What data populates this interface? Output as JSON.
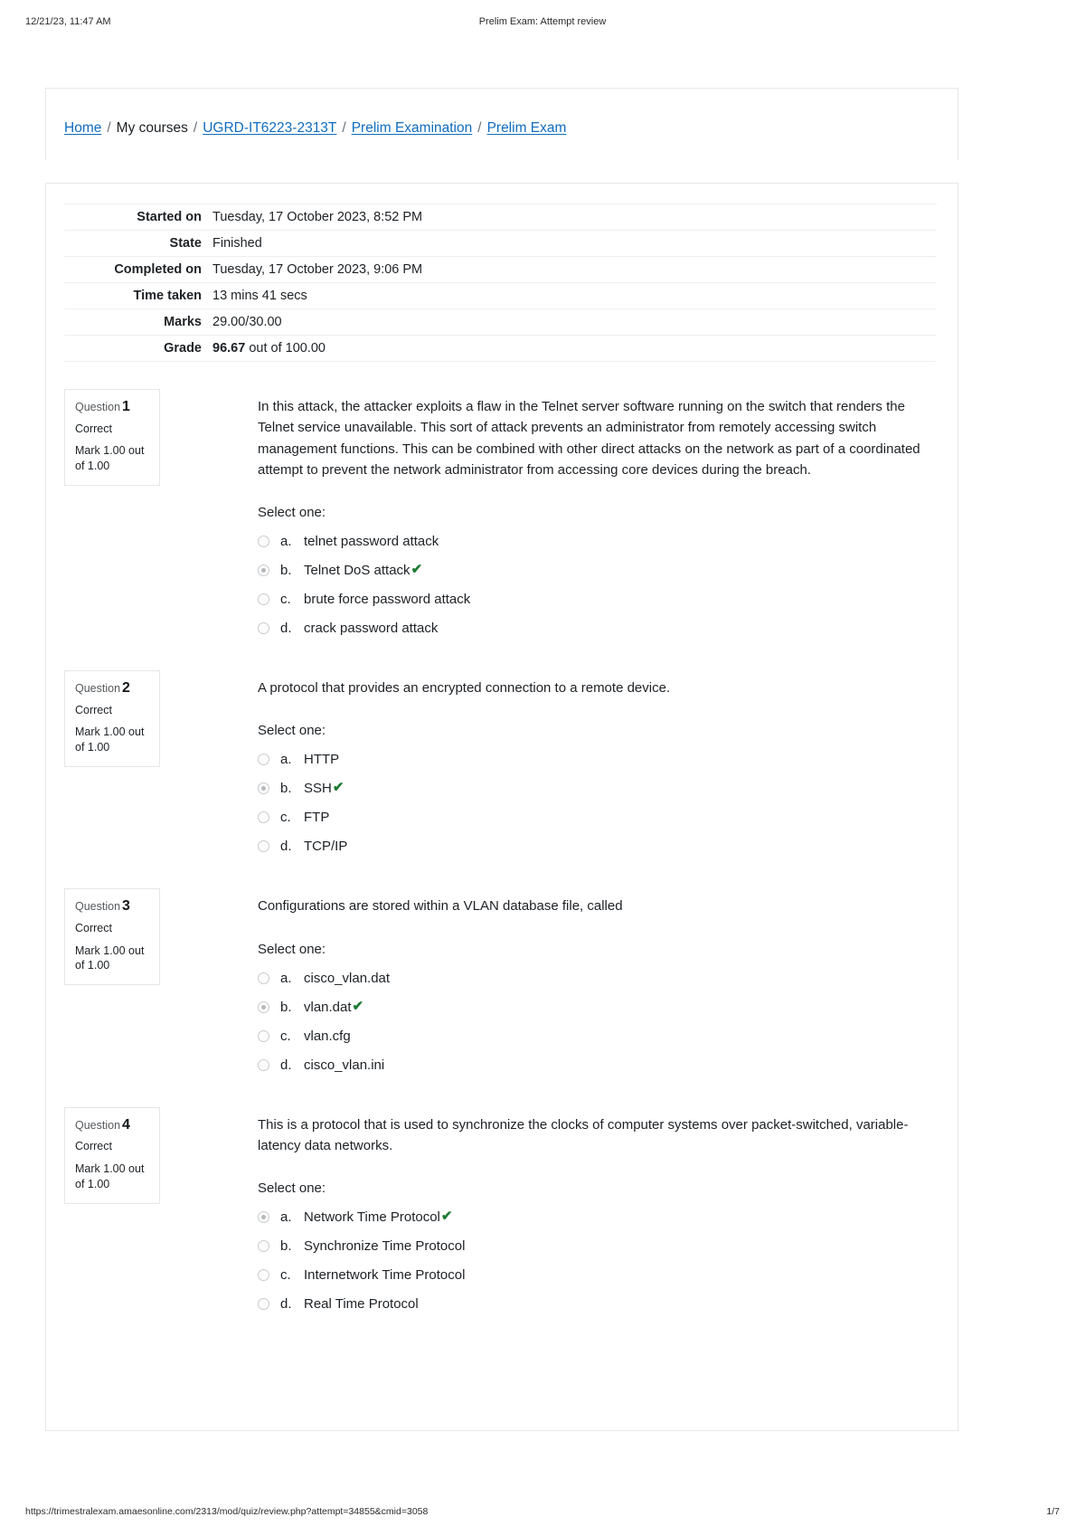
{
  "print_header": {
    "left": "12/21/23, 11:47 AM",
    "center": "Prelim Exam: Attempt review"
  },
  "print_footer": {
    "url": "https://trimestralexam.amaesonline.com/2313/mod/quiz/review.php?attempt=34855&cmid=3058",
    "page": "1/7"
  },
  "breadcrumb": {
    "home": "Home",
    "my_courses": "My courses",
    "course": "UGRD-IT6223-2313T",
    "section": "Prelim Examination",
    "activity": "Prelim Exam",
    "separator": "/"
  },
  "summary": {
    "rows": [
      {
        "label": "Started on",
        "value": "Tuesday, 17 October 2023, 8:52 PM"
      },
      {
        "label": "State",
        "value": "Finished"
      },
      {
        "label": "Completed on",
        "value": "Tuesday, 17 October 2023, 9:06 PM"
      },
      {
        "label": "Time taken",
        "value": "13 mins 41 secs"
      },
      {
        "label": "Marks",
        "value": "29.00/30.00"
      }
    ],
    "grade_label": "Grade",
    "grade_value": "96.67",
    "grade_suffix": "out of 100.00"
  },
  "labels": {
    "question_prefix": "Question",
    "select_one": "Select one:",
    "correct_tick": "✔"
  },
  "questions": [
    {
      "number": "1",
      "state": "Correct",
      "mark": "Mark 1.00 out of 1.00",
      "text": "In this attack, the attacker exploits a flaw in the Telnet server software running on the switch that renders the Telnet service unavailable. This sort of attack prevents an administrator from remotely accessing switch management functions. This can be combined with other direct attacks on the network as part of a coordinated attempt to prevent the network administrator from accessing core devices during the breach.",
      "options": [
        {
          "letter": "a.",
          "text": "telnet password attack",
          "selected": false,
          "correct": false
        },
        {
          "letter": "b.",
          "text": "Telnet DoS attack",
          "selected": true,
          "correct": true
        },
        {
          "letter": "c.",
          "text": "brute force password attack",
          "selected": false,
          "correct": false
        },
        {
          "letter": "d.",
          "text": "crack password attack",
          "selected": false,
          "correct": false
        }
      ]
    },
    {
      "number": "2",
      "state": "Correct",
      "mark": "Mark 1.00 out of 1.00",
      "text": "A protocol that provides an encrypted connection to a remote device.",
      "options": [
        {
          "letter": "a.",
          "text": "HTTP",
          "selected": false,
          "correct": false
        },
        {
          "letter": "b.",
          "text": "SSH",
          "selected": true,
          "correct": true
        },
        {
          "letter": "c.",
          "text": "FTP",
          "selected": false,
          "correct": false
        },
        {
          "letter": "d.",
          "text": "TCP/IP",
          "selected": false,
          "correct": false
        }
      ]
    },
    {
      "number": "3",
      "state": "Correct",
      "mark": "Mark 1.00 out of 1.00",
      "text": "Configurations are stored within a VLAN database file, called",
      "options": [
        {
          "letter": "a.",
          "text": "cisco_vlan.dat",
          "selected": false,
          "correct": false
        },
        {
          "letter": "b.",
          "text": "vlan.dat",
          "selected": true,
          "correct": true
        },
        {
          "letter": "c.",
          "text": "vlan.cfg",
          "selected": false,
          "correct": false
        },
        {
          "letter": "d.",
          "text": "cisco_vlan.ini",
          "selected": false,
          "correct": false
        }
      ]
    },
    {
      "number": "4",
      "state": "Correct",
      "mark": "Mark 1.00 out of 1.00",
      "text": "This is a protocol that is used to synchronize the clocks of computer systems over packet-switched, variable-latency data networks.",
      "options": [
        {
          "letter": "a.",
          "text": "Network Time Protocol",
          "selected": true,
          "correct": true
        },
        {
          "letter": "b.",
          "text": "Synchronize Time Protocol",
          "selected": false,
          "correct": false
        },
        {
          "letter": "c.",
          "text": "Internetwork Time Protocol",
          "selected": false,
          "correct": false
        },
        {
          "letter": "d.",
          "text": "Real Time Protocol",
          "selected": false,
          "correct": false
        }
      ]
    }
  ]
}
